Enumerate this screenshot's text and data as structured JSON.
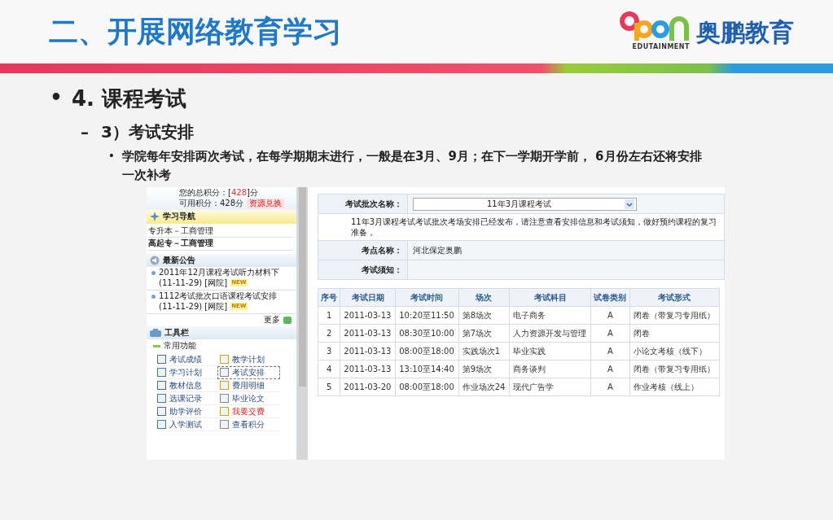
{
  "header": {
    "title": "二、开展网络教育学习",
    "logo_tagline": "EDUTAINMENT",
    "brand": "奥鹏教育"
  },
  "outline": [
    {
      "marker": "•",
      "text": "4. 课程考试",
      "children": [
        {
          "marker": "–",
          "text": "3）考试安排",
          "children": [
            {
              "marker": "•",
              "text": "学院每年安排两次考试，在每学期期末进行，一般是在3月、9月；在下一学期开学前， 6月份左右还将安排一次补考"
            }
          ]
        }
      ]
    }
  ],
  "screenshot": {
    "sidebar": {
      "total_label": "您的总积分：[",
      "total_value": "428",
      "total_suffix": "]分",
      "available": "可用积分：428分",
      "redeem_button": "资源兑换",
      "nav": {
        "title": "学习导航",
        "items": [
          {
            "text": "专升本－工商管理",
            "selected": false
          },
          {
            "text": "高起专－工商管理",
            "selected": true
          }
        ]
      },
      "notices": {
        "title": "最新公告",
        "items": [
          {
            "text": "2011年12月课程考试听力材料下",
            "meta": "(11-11-29) [网院]",
            "badge": "NEW"
          },
          {
            "text": "1112考试批次口语课程考试安排",
            "meta": "(11-11-29) [网院]",
            "badge": "NEW"
          }
        ],
        "more": "更多"
      },
      "toolbar": {
        "title": "工具栏",
        "group": "常用功能",
        "items": [
          {
            "label": "考试成绩",
            "selected": false,
            "alert": false
          },
          {
            "label": "教学计划",
            "selected": false,
            "alert": false
          },
          {
            "label": "学习计划",
            "selected": false,
            "alert": false
          },
          {
            "label": "考试安排",
            "selected": true,
            "alert": false
          },
          {
            "label": "教材信息",
            "selected": false,
            "alert": false
          },
          {
            "label": "费用明细",
            "selected": false,
            "alert": false
          },
          {
            "label": "选课记录",
            "selected": false,
            "alert": false
          },
          {
            "label": "毕业论文",
            "selected": false,
            "alert": false
          },
          {
            "label": "助学评价",
            "selected": false,
            "alert": false
          },
          {
            "label": "我要交费",
            "selected": false,
            "alert": true
          },
          {
            "label": "入学测试",
            "selected": false,
            "alert": false
          },
          {
            "label": "查看积分",
            "selected": false,
            "alert": false
          }
        ]
      }
    },
    "form": {
      "batch_label": "考试批次名称：",
      "batch_value": "11年3月课程考试",
      "notice": "11年3月课程考试考试批次考场安排已经发布，请注意查看安排信息和考试须知，做好预约课程的复习准备，",
      "site_label": "考点名称：",
      "site_value": "河北保定奥鹏",
      "rules_label": "考试须知："
    },
    "table": {
      "columns": [
        "序号",
        "考试日期",
        "考试时间",
        "场次",
        "考试科目",
        "试卷类别",
        "考试形式"
      ],
      "rows": [
        [
          "1",
          "2011-03-13",
          "10:20至11:50",
          "第8场次",
          "电子商务",
          "A",
          "闭卷（带复习专用纸）"
        ],
        [
          "2",
          "2011-03-13",
          "08:30至10:00",
          "第7场次",
          "人力资源开发与管理",
          "A",
          "闭卷"
        ],
        [
          "3",
          "2011-03-13",
          "08:00至18:00",
          "实践场次1",
          "毕业实践",
          "A",
          "小论文考核（线下）"
        ],
        [
          "4",
          "2011-03-13",
          "13:10至14:40",
          "第9场次",
          "商务谈判",
          "A",
          "闭卷（带复习专用纸）"
        ],
        [
          "5",
          "2011-03-20",
          "08:00至18:00",
          "作业场次24",
          "现代广告学",
          "A",
          "作业考核（线上）"
        ]
      ]
    }
  }
}
